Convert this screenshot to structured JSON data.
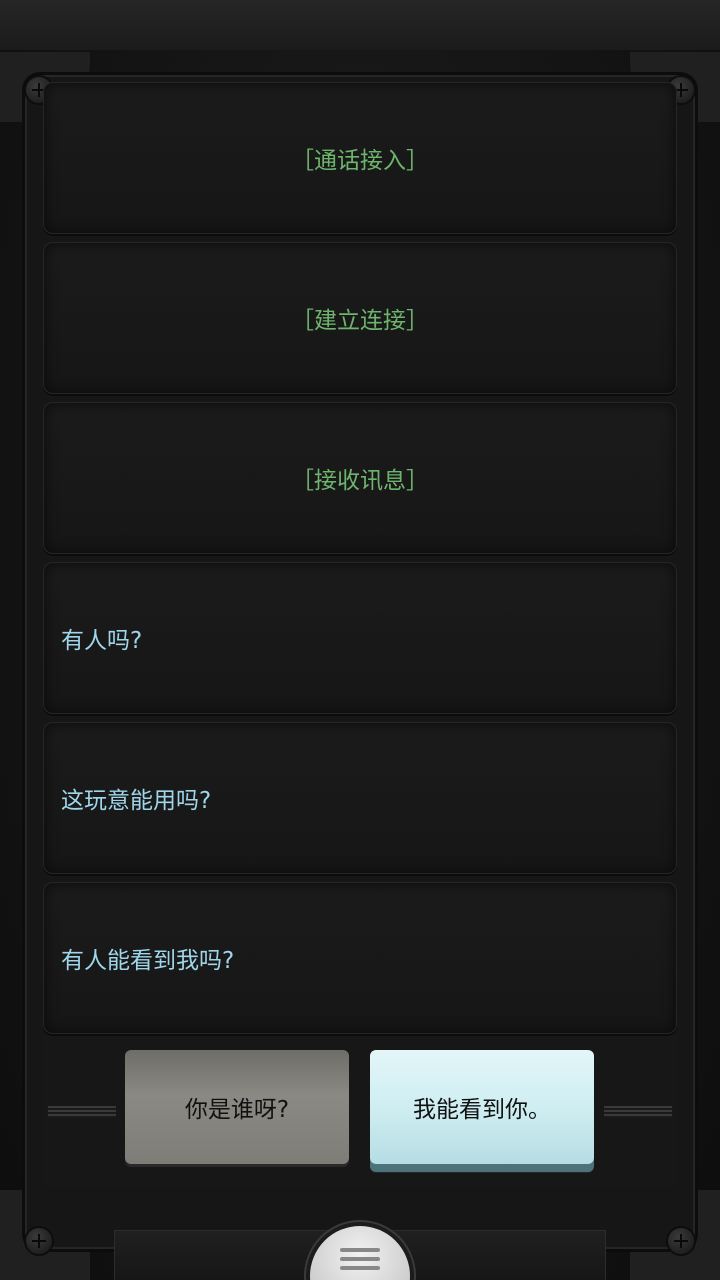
{
  "conversation": {
    "system_entries": [
      {
        "text": "［通话接入］"
      },
      {
        "text": "［建立连接］"
      },
      {
        "text": "［接收讯息］"
      }
    ],
    "messages": [
      {
        "text": "有人吗?"
      },
      {
        "text": "这玩意能用吗?"
      },
      {
        "text": "有人能看到我吗?"
      }
    ]
  },
  "choices": {
    "left_label": "你是谁呀?",
    "right_label": "我能看到你。"
  },
  "menu": {
    "icon": "hamburger-menu-icon"
  },
  "colors": {
    "system_text": "#6db56d",
    "message_text": "#9fd6ea"
  }
}
